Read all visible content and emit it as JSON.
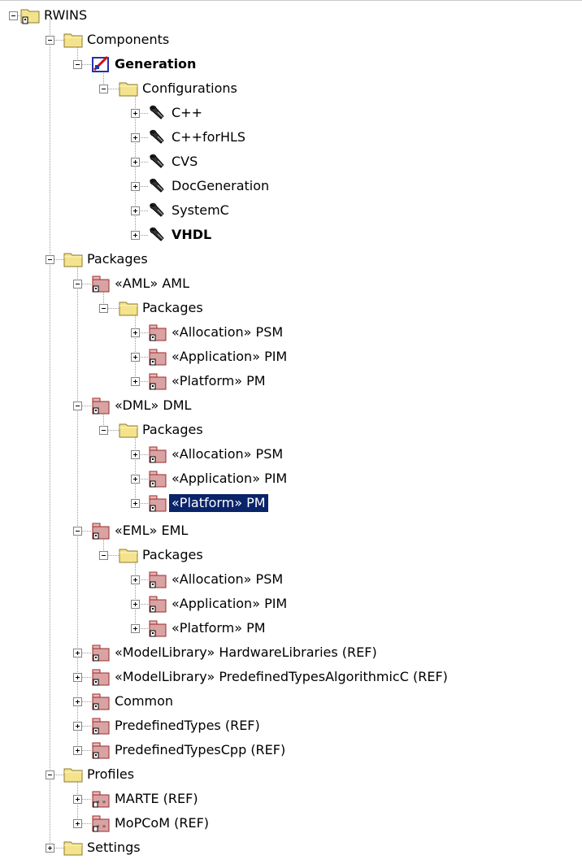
{
  "tree": [
    {
      "label": "RWINS",
      "depth": 0,
      "icon": "project",
      "state": "minus"
    },
    {
      "label": "Components",
      "depth": 1,
      "icon": "folder",
      "state": "minus"
    },
    {
      "label": "Generation",
      "depth": 2,
      "icon": "component",
      "state": "minus",
      "bold": true
    },
    {
      "label": "Configurations",
      "depth": 3,
      "icon": "folder",
      "state": "minus"
    },
    {
      "label": "C++",
      "depth": 4,
      "icon": "wrench",
      "state": "plus"
    },
    {
      "label": "C++forHLS",
      "depth": 4,
      "icon": "wrench",
      "state": "plus"
    },
    {
      "label": "CVS",
      "depth": 4,
      "icon": "wrench",
      "state": "plus"
    },
    {
      "label": "DocGeneration",
      "depth": 4,
      "icon": "wrench",
      "state": "plus"
    },
    {
      "label": "SystemC",
      "depth": 4,
      "icon": "wrench",
      "state": "plus"
    },
    {
      "label": "VHDL",
      "depth": 4,
      "icon": "wrench",
      "state": "plus",
      "bold": true
    },
    {
      "label": "Packages",
      "depth": 1,
      "icon": "folder",
      "state": "minus"
    },
    {
      "label": "«AML» AML",
      "depth": 2,
      "icon": "package",
      "state": "minus"
    },
    {
      "label": "Packages",
      "depth": 3,
      "icon": "folder",
      "state": "minus"
    },
    {
      "label": "«Allocation» PSM",
      "depth": 4,
      "icon": "package",
      "state": "plus"
    },
    {
      "label": "«Application» PIM",
      "depth": 4,
      "icon": "package",
      "state": "plus"
    },
    {
      "label": "«Platform» PM",
      "depth": 4,
      "icon": "package",
      "state": "plus"
    },
    {
      "label": "«DML» DML",
      "depth": 2,
      "icon": "package",
      "state": "minus"
    },
    {
      "label": "Packages",
      "depth": 3,
      "icon": "folder",
      "state": "minus"
    },
    {
      "label": "«Allocation» PSM",
      "depth": 4,
      "icon": "package",
      "state": "plus"
    },
    {
      "label": "«Application» PIM",
      "depth": 4,
      "icon": "package",
      "state": "plus"
    },
    {
      "label": "«Platform» PM",
      "depth": 4,
      "icon": "package",
      "state": "plus",
      "selected": true
    },
    {
      "label": "«EML» EML",
      "depth": 2,
      "icon": "package",
      "state": "minus"
    },
    {
      "label": "Packages",
      "depth": 3,
      "icon": "folder",
      "state": "minus"
    },
    {
      "label": "«Allocation» PSM",
      "depth": 4,
      "icon": "package",
      "state": "plus"
    },
    {
      "label": "«Application» PIM",
      "depth": 4,
      "icon": "package",
      "state": "plus"
    },
    {
      "label": "«Platform» PM",
      "depth": 4,
      "icon": "package",
      "state": "plus"
    },
    {
      "label": "«ModelLibrary» HardwareLibraries (REF)",
      "depth": 2,
      "icon": "package",
      "state": "plus"
    },
    {
      "label": "«ModelLibrary» PredefinedTypesAlgorithmicC (REF)",
      "depth": 2,
      "icon": "package",
      "state": "plus"
    },
    {
      "label": "Common",
      "depth": 2,
      "icon": "package",
      "state": "plus"
    },
    {
      "label": "PredefinedTypes (REF)",
      "depth": 2,
      "icon": "package",
      "state": "plus"
    },
    {
      "label": "PredefinedTypesCpp (REF)",
      "depth": 2,
      "icon": "package",
      "state": "plus"
    },
    {
      "label": "Profiles",
      "depth": 1,
      "icon": "folder",
      "state": "minus"
    },
    {
      "label": "MARTE (REF)",
      "depth": 2,
      "icon": "profile",
      "state": "plus"
    },
    {
      "label": "MoPCoM (REF)",
      "depth": 2,
      "icon": "profile",
      "state": "plus"
    },
    {
      "label": "Settings",
      "depth": 1,
      "icon": "folder",
      "state": "plus"
    }
  ],
  "colors": {
    "selection_bg": "#0a246a",
    "selection_fg": "#ffffff",
    "folder": "#f3e38c",
    "package": "#d9a3a3",
    "package_border": "#9c2b2b"
  }
}
